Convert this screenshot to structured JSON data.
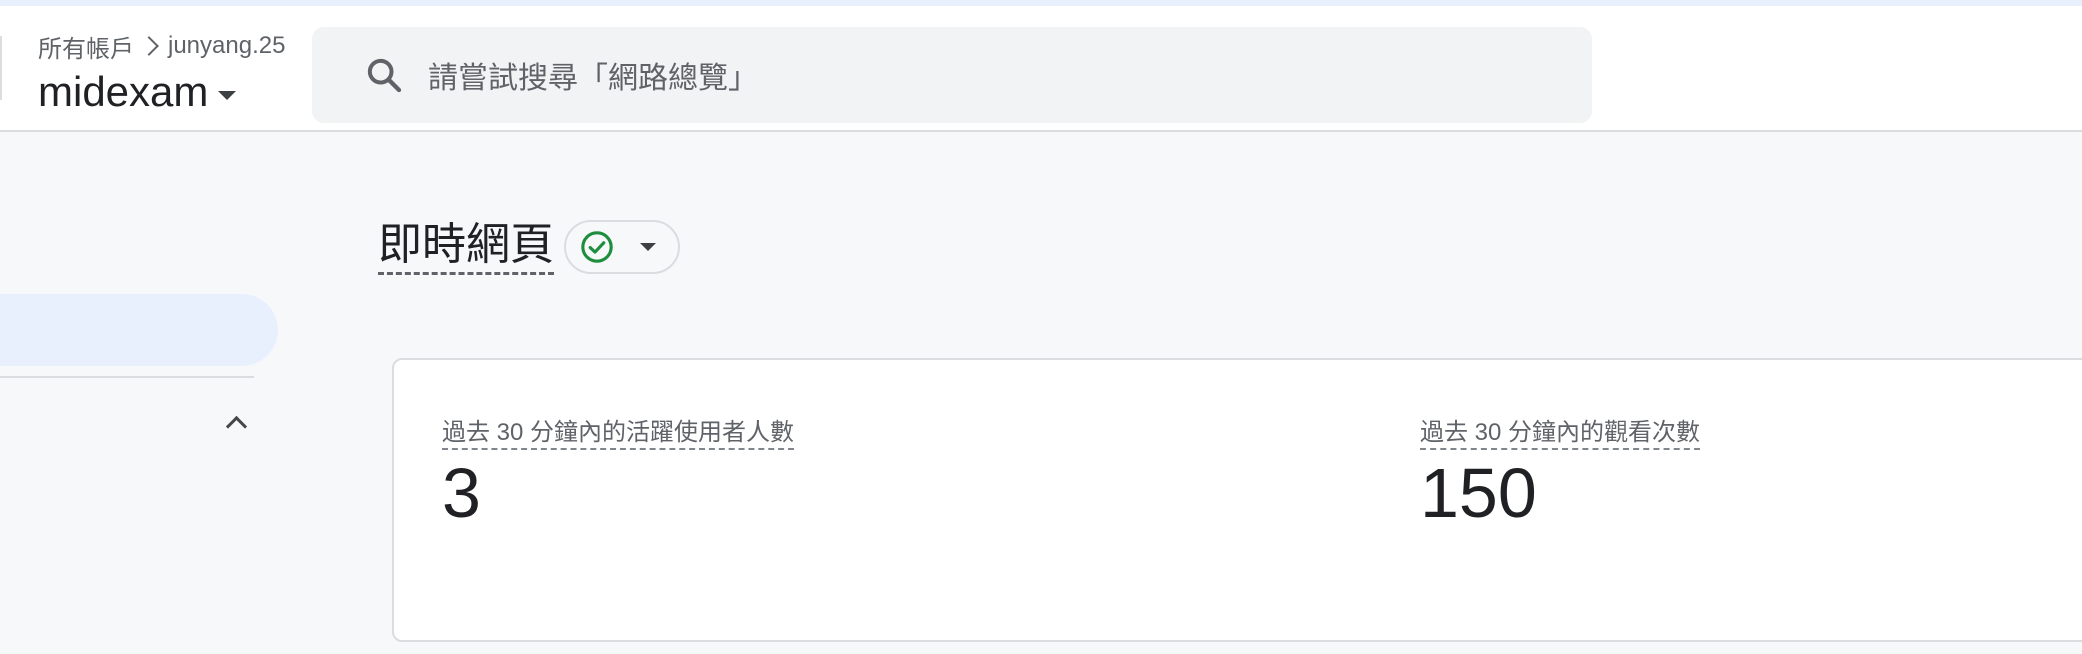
{
  "header": {
    "breadcrumb": {
      "root": "所有帳戶",
      "account": "junyang.25"
    },
    "property_name": "midexam",
    "search": {
      "placeholder": "請嘗試搜尋「網路總覽」",
      "icon": "search-icon"
    }
  },
  "page": {
    "title": "即時網頁",
    "status_icon": "check-circle-icon",
    "status_color": "#1e8e3e"
  },
  "metrics": [
    {
      "label": "過去 30 分鐘內的活躍使用者人數",
      "value": "3"
    },
    {
      "label": "過去 30 分鐘內的觀看次數",
      "value": "150"
    }
  ],
  "colors": {
    "accent_light": "#e8f0fe",
    "background": "#f7f8fa"
  }
}
